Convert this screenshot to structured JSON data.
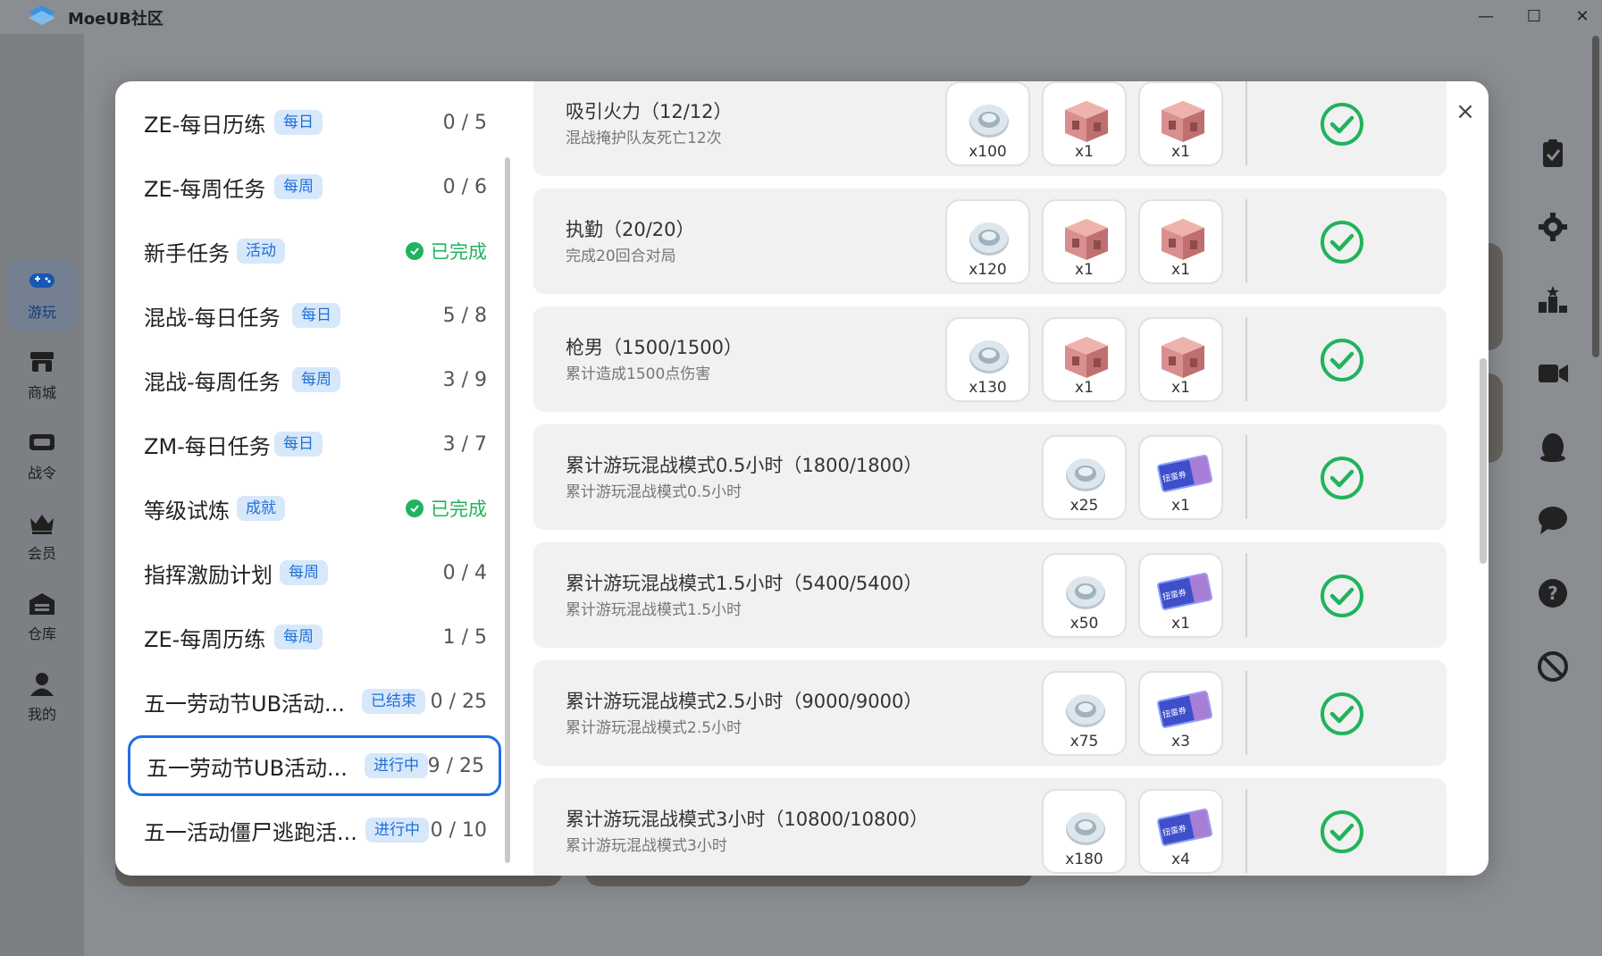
{
  "app": {
    "title": "MoeUB社区"
  },
  "window": {
    "minimize": "—",
    "maximize": "☐",
    "close": "✕"
  },
  "nav": [
    {
      "label": "游玩",
      "icon": "gamepad-icon",
      "active": true
    },
    {
      "label": "商城",
      "icon": "store-icon"
    },
    {
      "label": "战令",
      "icon": "ticket-icon"
    },
    {
      "label": "会员",
      "icon": "crown-icon"
    },
    {
      "label": "仓库",
      "icon": "warehouse-icon"
    },
    {
      "label": "我的",
      "icon": "user-icon"
    }
  ],
  "right_icons": [
    "clipboard-check-icon",
    "gear-icon",
    "leaderboard-icon",
    "video-camera-icon",
    "penguin-icon",
    "chat-bubble-icon",
    "help-icon",
    "ban-icon"
  ],
  "modal": {
    "close": "×",
    "tasks": [
      {
        "name": "ZE-每日历练",
        "tag": "每日",
        "progress": "0 / 5"
      },
      {
        "name": "ZE-每周任务",
        "tag": "每周",
        "progress": "0 / 6"
      },
      {
        "name": "新手任务",
        "tag": "活动",
        "progress": "已完成",
        "done": true
      },
      {
        "name": "混战-每日任务",
        "tag": "每日",
        "progress": "5 / 8"
      },
      {
        "name": "混战-每周任务",
        "tag": "每周",
        "progress": "3 / 9"
      },
      {
        "name": "ZM-每日任务",
        "tag": "每日",
        "progress": "3 / 7"
      },
      {
        "name": "等级试炼",
        "tag": "成就",
        "progress": "已完成",
        "done": true
      },
      {
        "name": "指挥激励计划",
        "tag": "每周",
        "progress": "0 / 4"
      },
      {
        "name": "ZE-每周历练",
        "tag": "每周",
        "progress": "1 / 5"
      },
      {
        "name": "五一劳动节UB活动...",
        "tag": "已结束",
        "progress": "0 / 25"
      },
      {
        "name": "五一劳动节UB活动...",
        "tag": "进行中",
        "progress": "9 / 25",
        "selected": true
      },
      {
        "name": "五一活动僵尸逃跑活...",
        "tag": "进行中",
        "progress": "0 / 10"
      }
    ],
    "rows": [
      {
        "title": "吸引火力（12/12）",
        "desc": "混战掩护队友死亡12次",
        "rewards": [
          {
            "icon": "coin-icon",
            "qty": "x100"
          },
          {
            "icon": "crate-icon",
            "qty": "x1"
          },
          {
            "icon": "crate-icon",
            "qty": "x1"
          }
        ]
      },
      {
        "title": "执勤（20/20）",
        "desc": "完成20回合对局",
        "rewards": [
          {
            "icon": "coin-icon",
            "qty": "x120"
          },
          {
            "icon": "crate-icon",
            "qty": "x1"
          },
          {
            "icon": "crate-icon",
            "qty": "x1"
          }
        ]
      },
      {
        "title": "枪男（1500/1500）",
        "desc": "累计造成1500点伤害",
        "rewards": [
          {
            "icon": "coin-icon",
            "qty": "x130"
          },
          {
            "icon": "crate-icon",
            "qty": "x1"
          },
          {
            "icon": "crate-icon",
            "qty": "x1"
          }
        ]
      },
      {
        "title": "累计游玩混战模式0.5小时（1800/1800）",
        "desc": "累计游玩混战模式0.5小时",
        "rewards": [
          {
            "icon": "coin-icon",
            "qty": "x25"
          },
          {
            "icon": "gacha-ticket-icon",
            "qty": "x1",
            "label": "扭蛋券"
          }
        ]
      },
      {
        "title": "累计游玩混战模式1.5小时（5400/5400）",
        "desc": "累计游玩混战模式1.5小时",
        "rewards": [
          {
            "icon": "coin-icon",
            "qty": "x50"
          },
          {
            "icon": "gacha-ticket-icon",
            "qty": "x1",
            "label": "扭蛋券"
          }
        ]
      },
      {
        "title": "累计游玩混战模式2.5小时（9000/9000）",
        "desc": "累计游玩混战模式2.5小时",
        "rewards": [
          {
            "icon": "coin-icon",
            "qty": "x75"
          },
          {
            "icon": "gacha-ticket-icon",
            "qty": "x3",
            "label": "扭蛋券"
          }
        ]
      },
      {
        "title": "累计游玩混战模式3小时（10800/10800）",
        "desc": "累计游玩混战模式3小时",
        "rewards": [
          {
            "icon": "coin-icon",
            "qty": "x180"
          },
          {
            "icon": "gacha-ticket-icon",
            "qty": "x4",
            "label": "扭蛋券"
          }
        ]
      }
    ]
  },
  "colors": {
    "accent": "#1e6ee8",
    "done": "#21b35d",
    "tag_bg": "#d7e8fb"
  }
}
